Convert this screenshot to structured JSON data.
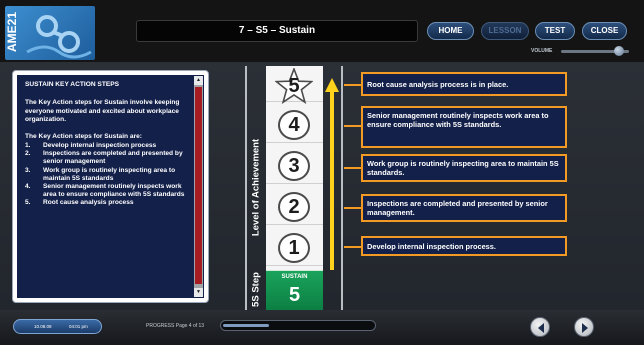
{
  "app": {
    "logo_text": "AME21",
    "title": "7 – S5 – Sustain"
  },
  "nav": {
    "home": "HOME",
    "lesson": "LESSON",
    "test": "TEST",
    "close": "CLOSE",
    "volume_label": "VOLUME",
    "volume_level": 0.78
  },
  "panel": {
    "heading": "SUSTAIN KEY ACTION STEPS",
    "intro": "The Key Action steps for Sustain involve keeping everyone motivated and excited about workplace organization.",
    "steps_intro": "The Key Action steps for Sustain are:",
    "steps": [
      {
        "num": "1.",
        "text": "Develop internal inspection process"
      },
      {
        "num": "2.",
        "text": "Inspections are completed and presented by senior management"
      },
      {
        "num": "3.",
        "text": "Work group is routinely inspecting area to maintain 5S standards"
      },
      {
        "num": "4.",
        "text": "Senior management routinely inspects work area to ensure compliance with 5S standards"
      },
      {
        "num": "5.",
        "text": "Root cause analysis process"
      }
    ]
  },
  "diagram": {
    "level_axis_label": "Level of Achievement",
    "step_axis_label": "5S Step",
    "levels": [
      "5",
      "4",
      "3",
      "2",
      "1"
    ],
    "step_name": "SUSTAIN",
    "step_number": "5",
    "descriptions": [
      "Root cause analysis process is in place.",
      "Senior management routinely inspects work area to ensure compliance with 5S standards.",
      "Work group is routinely inspecting area to maintain 5S standards.",
      "Inspections are completed and presented by senior management.",
      "Develop internal inspection process."
    ],
    "colors": {
      "accent_orange": "#f39a24",
      "arrow_yellow": "#ffd21b",
      "box_navy": "#13204a",
      "sustain_green": "#1aa35b"
    }
  },
  "footer": {
    "date": "10.08.09",
    "time": "04:01 pm",
    "progress_label": "PROGRESS Page 4 of 13",
    "progress_fraction": 0.3077,
    "prev_icon": "chevron-left-icon",
    "next_icon": "chevron-right-icon"
  }
}
